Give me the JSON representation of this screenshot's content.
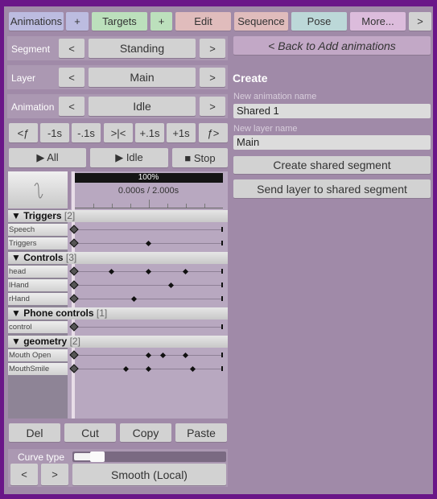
{
  "tabs": [
    {
      "label": "Animations",
      "color": "#bcbce0"
    },
    {
      "label": "+",
      "color": "#bcbce0"
    },
    {
      "label": "Targets",
      "color": "#bce0bc"
    },
    {
      "label": "+",
      "color": "#bce0bc"
    },
    {
      "label": "Edit",
      "color": "#e0bcbc"
    },
    {
      "label": "Sequence",
      "color": "#e0bcbc"
    },
    {
      "label": "Pose",
      "color": "#bcd8d8"
    },
    {
      "label": "More...",
      "color": "#dcbcdc"
    },
    {
      "label": ">",
      "color": "#d2d2d2"
    }
  ],
  "selectors": [
    {
      "label": "Segment",
      "value": "Standing",
      "prev": "<",
      "next": ">"
    },
    {
      "label": "Layer",
      "value": "Main",
      "prev": "<",
      "next": ">"
    },
    {
      "label": "Animation",
      "value": "Idle",
      "prev": "<",
      "next": ">"
    }
  ],
  "frame_buttons": [
    "<ƒ",
    "-1s",
    "-.1s",
    ">|<",
    "+.1s",
    "+1s",
    "ƒ>"
  ],
  "play": {
    "all": "▶ All",
    "current": "▶ Idle",
    "stop": "■ Stop"
  },
  "timeline": {
    "zoom": "100%",
    "time": "0.000s / 2.000s",
    "duration": 2.0,
    "current_time": 0.0,
    "groups": [
      {
        "name": "▼ Triggers",
        "count": "[2]",
        "tracks": [
          {
            "name": "Speech",
            "keys": [
              0
            ]
          },
          {
            "name": "Triggers",
            "keys": [
              0,
              1.0
            ]
          }
        ]
      },
      {
        "name": "▼ Controls",
        "count": "[3]",
        "tracks": [
          {
            "name": "head",
            "keys": [
              0,
              0.5,
              1.0,
              1.5
            ]
          },
          {
            "name": "lHand",
            "keys": [
              0,
              1.3
            ]
          },
          {
            "name": "rHand",
            "keys": [
              0,
              0.8
            ]
          }
        ]
      },
      {
        "name": "▼ Phone controls",
        "count": "[1]",
        "tracks": [
          {
            "name": "control",
            "keys": [
              0
            ]
          }
        ]
      },
      {
        "name": "▼ geometry",
        "count": "[2]",
        "tracks": [
          {
            "name": "Mouth Open",
            "keys": [
              0,
              1.0,
              1.2,
              1.5
            ]
          },
          {
            "name": "MouthSmile",
            "keys": [
              0,
              0.7,
              1.0,
              1.6
            ]
          }
        ]
      }
    ]
  },
  "edit_buttons": [
    "Del",
    "Cut",
    "Copy",
    "Paste"
  ],
  "curve": {
    "label": "Curve type",
    "prev": "<",
    "next": ">",
    "value": "Smooth (Local)",
    "slider_fraction": 0.2
  },
  "right": {
    "back": "< Back to Add animations",
    "heading": "Create",
    "anim_label": "New animation name",
    "anim_value": "Shared 1",
    "layer_label": "New layer name",
    "layer_value": "Main",
    "create_btn": "Create shared segment",
    "send_btn": "Send layer to shared segment"
  }
}
